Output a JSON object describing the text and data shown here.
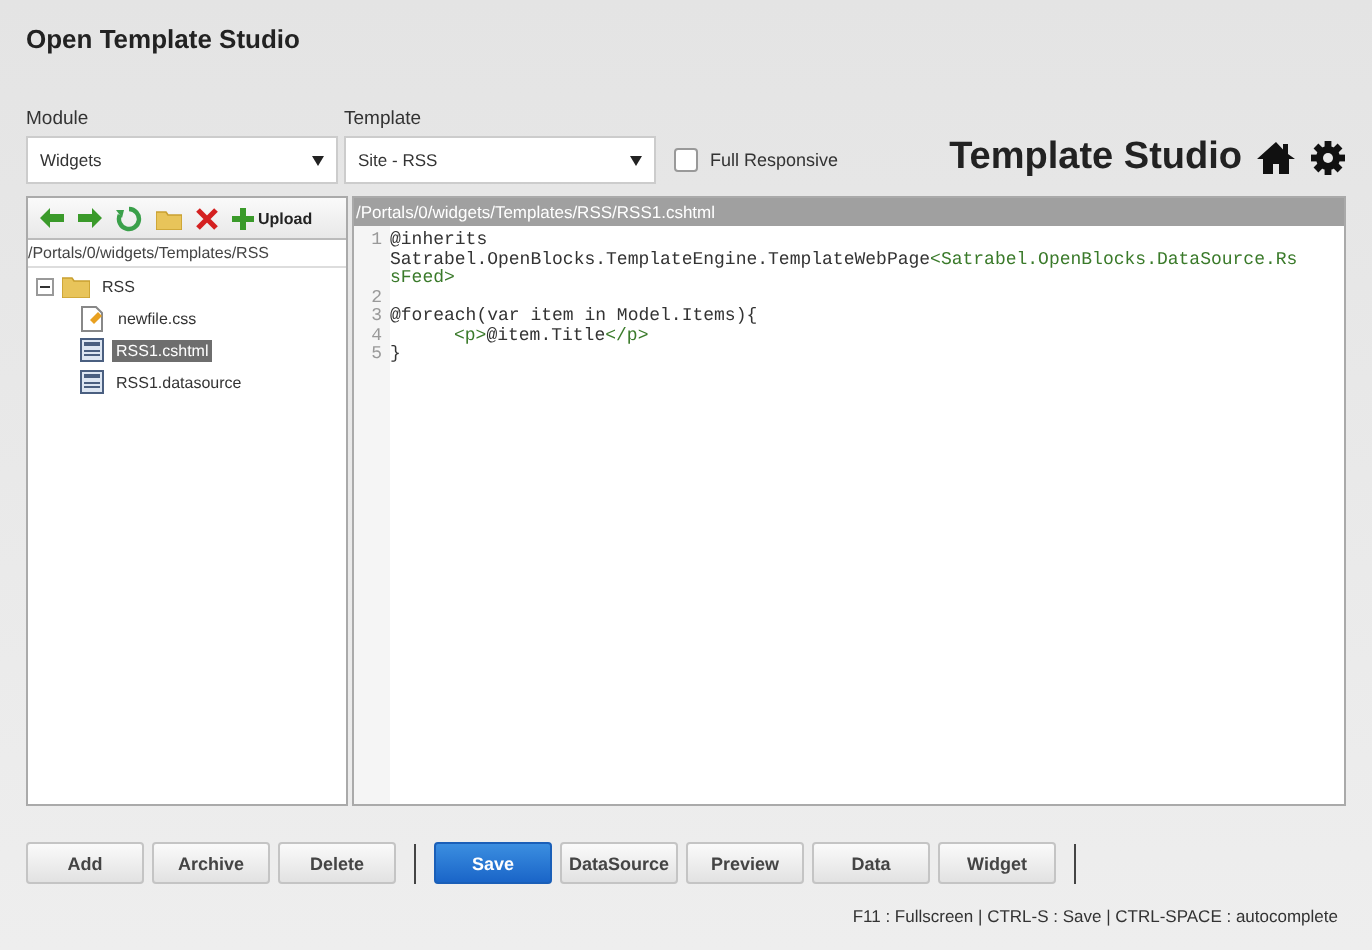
{
  "window": {
    "title": "Open Template Studio"
  },
  "module": {
    "label": "Module",
    "value": "Widgets"
  },
  "template": {
    "label": "Template",
    "value": "Site - RSS"
  },
  "full_responsive": {
    "label": "Full Responsive",
    "checked": false
  },
  "brand": {
    "title": "Template Studio"
  },
  "file_panel": {
    "upload_label": "Upload",
    "path": "/Portals/0/widgets/Templates/RSS",
    "tree": [
      {
        "name": "RSS",
        "kind": "folder",
        "expanded": true,
        "selected": false,
        "children": [
          {
            "name": "newfile.css",
            "kind": "css",
            "selected": false
          },
          {
            "name": "RSS1.cshtml",
            "kind": "page",
            "selected": true
          },
          {
            "name": "RSS1.datasource",
            "kind": "page",
            "selected": false
          }
        ]
      }
    ]
  },
  "editor": {
    "path": "/Portals/0/widgets/Templates/RSS/RSS1.cshtml",
    "lines": [
      {
        "number": "1",
        "indented": false,
        "segments": [
          {
            "kind": "plain",
            "text": "@inherits Satrabel.OpenBlocks.TemplateEngine.TemplateWebPage"
          },
          {
            "kind": "tag",
            "text": "<Satrabel.OpenBlocks.DataSource.RssFeed>"
          }
        ]
      },
      {
        "number": "2"
      },
      {
        "number": "3",
        "indented": false,
        "segments": [
          {
            "kind": "plain",
            "text": "@foreach(var item in Model.Items){"
          }
        ]
      },
      {
        "number": "4",
        "indented": true,
        "segments": [
          {
            "kind": "tag",
            "text": "<p>"
          },
          {
            "kind": "plain",
            "text": "@item.Title"
          },
          {
            "kind": "tag",
            "text": "</p>"
          }
        ]
      },
      {
        "number": "5",
        "indented": false,
        "segments": [
          {
            "kind": "plain",
            "text": "}"
          }
        ]
      }
    ]
  },
  "button_groups": [
    [
      {
        "label": "Add",
        "kind": "default"
      },
      {
        "label": "Archive",
        "kind": "default"
      },
      {
        "label": "Delete",
        "kind": "default"
      }
    ],
    [
      {
        "label": "Save",
        "kind": "primary"
      },
      {
        "label": "DataSource",
        "kind": "default"
      },
      {
        "label": "Preview",
        "kind": "default"
      },
      {
        "label": "Data",
        "kind": "default"
      },
      {
        "label": "Widget",
        "kind": "default"
      }
    ]
  ],
  "shortcuts": "F11 : Fullscreen | CTRL-S : Save | CTRL-SPACE : autocomplete"
}
